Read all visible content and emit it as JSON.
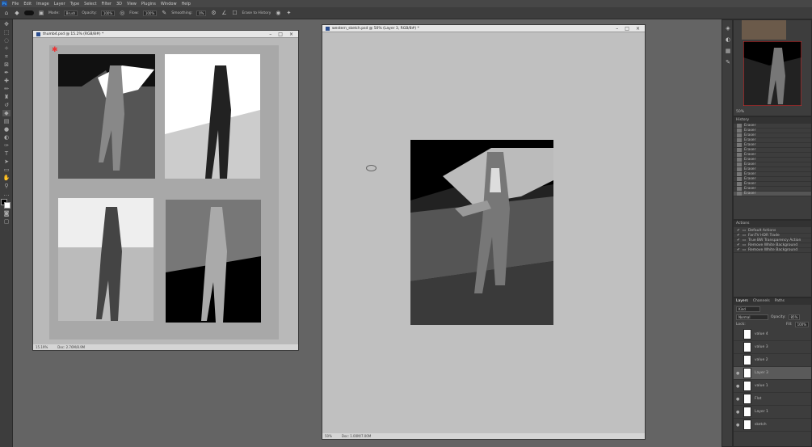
{
  "app": {
    "logo": "Ps"
  },
  "menu": [
    "File",
    "Edit",
    "Image",
    "Layer",
    "Type",
    "Select",
    "Filter",
    "3D",
    "View",
    "Plugins",
    "Window",
    "Help"
  ],
  "options": {
    "mode_label": "Mode:",
    "mode_value": "Brush",
    "opacity_label": "Opacity:",
    "opacity_value": "100%",
    "flow_label": "Flow:",
    "flow_value": "100%",
    "smoothing_label": "Smoothing:",
    "smoothing_value": "0%",
    "erase_history": "Erase to History"
  },
  "doc1": {
    "title": "thumb4.psd @ 15.2% (RGB/8#) *",
    "zoom": "15.19%",
    "docinfo": "Doc: 2.76M/8.9M"
  },
  "doc2": {
    "title": "western_sketch.psd @ 50% (Layer 3, RGB/8#) *",
    "zoom": "50%",
    "docinfo": "Doc: 1.00M/7.00M"
  },
  "navigator": {
    "zoom": "50%"
  },
  "history": {
    "title": "History",
    "items": [
      "Eraser",
      "Eraser",
      "Eraser",
      "Eraser",
      "Eraser",
      "Eraser",
      "Eraser",
      "Eraser",
      "Eraser",
      "Eraser",
      "Eraser",
      "Eraser",
      "Eraser",
      "Eraser",
      "Eraser"
    ]
  },
  "actions": {
    "title": "Actions",
    "items": [
      "Default Actions",
      "FanTV HDR Trade",
      "True BW Transparency Action",
      "Remove White Background",
      "Remove White Background"
    ]
  },
  "layers": {
    "tabs": [
      "Layers",
      "Channels",
      "Paths"
    ],
    "filter": "Kind",
    "blend": "Normal",
    "opacity_label": "Opacity:",
    "opacity": "85%",
    "lock_label": "Lock:",
    "fill_label": "Fill:",
    "fill": "100%",
    "items": [
      "value 4",
      "value 3",
      "value 2",
      "Layer 3",
      "value 1",
      "Flat",
      "Layer 1",
      "sketch"
    ]
  },
  "colors": {
    "bg": "#646464",
    "panel": "#3d3d3d",
    "accent": "#31a8ff"
  }
}
